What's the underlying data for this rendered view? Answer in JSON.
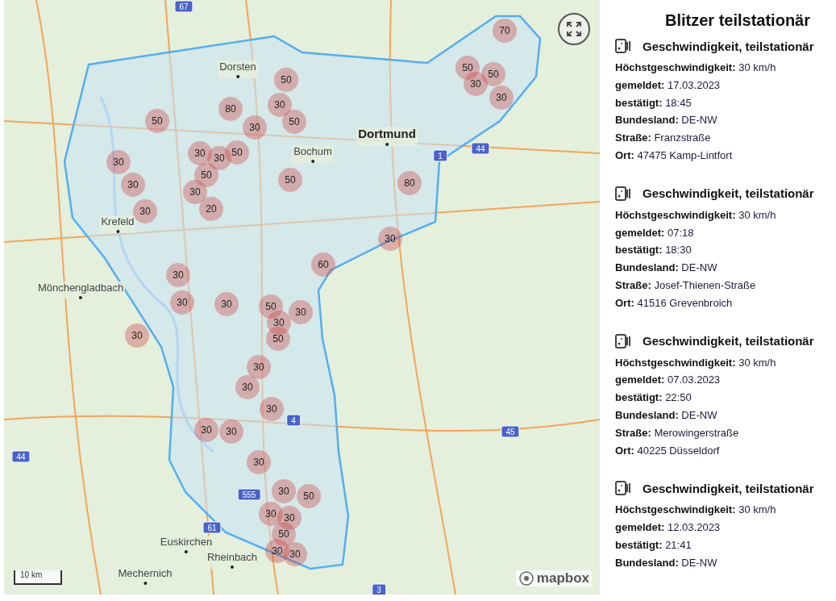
{
  "map": {
    "markers": [
      "70",
      "50",
      "30",
      "50",
      "30",
      "50",
      "30",
      "50",
      "80",
      "30",
      "50",
      "30",
      "30",
      "50",
      "50",
      "30",
      "30",
      "50",
      "30",
      "20",
      "80",
      "30",
      "30",
      "60",
      "30",
      "30",
      "30",
      "50",
      "30",
      "50",
      "30",
      "30",
      "30",
      "30",
      "30",
      "30",
      "30",
      "30",
      "30",
      "50",
      "30",
      "30",
      "50",
      "30",
      "30"
    ],
    "places": [
      {
        "name": "Dorsten",
        "kind": "town"
      },
      {
        "name": "Dortmund",
        "kind": "city"
      },
      {
        "name": "Bochum",
        "kind": "town"
      },
      {
        "name": "Krefeld",
        "kind": "town"
      },
      {
        "name": "Mönchengladbach",
        "kind": "town"
      },
      {
        "name": "Euskirchen",
        "kind": "town"
      },
      {
        "name": "Rheinbach",
        "kind": "town"
      },
      {
        "name": "Mechernich",
        "kind": "town"
      }
    ],
    "road_shields": [
      "67",
      "1",
      "44",
      "4",
      "45",
      "44",
      "555",
      "61",
      "3"
    ],
    "scale": "10 km",
    "attribution": "mapbox"
  },
  "sidebar": {
    "title": "Blitzer teilstationär",
    "entries": [
      {
        "title": "Geschwindigkeit, teilstationär",
        "fields": [
          {
            "label": "Höchstgeschwindigkeit:",
            "value": "30 km/h"
          },
          {
            "label": "gemeldet:",
            "value": "17.03.2023"
          },
          {
            "label": "bestätigt:",
            "value": "18:45"
          },
          {
            "label": "Bundesland:",
            "value": "DE-NW"
          },
          {
            "label": "Straße:",
            "value": "Franzstraße"
          },
          {
            "label": "Ort:",
            "value": "47475 Kamp-Lintfort"
          }
        ]
      },
      {
        "title": "Geschwindigkeit, teilstationär",
        "fields": [
          {
            "label": "Höchstgeschwindigkeit:",
            "value": "30 km/h"
          },
          {
            "label": "gemeldet:",
            "value": "07:18"
          },
          {
            "label": "bestätigt:",
            "value": "18:30"
          },
          {
            "label": "Bundesland:",
            "value": "DE-NW"
          },
          {
            "label": "Straße:",
            "value": "Josef-Thienen-Straße"
          },
          {
            "label": "Ort:",
            "value": "41516 Grevenbroich"
          }
        ]
      },
      {
        "title": "Geschwindigkeit, teilstationär",
        "fields": [
          {
            "label": "Höchstgeschwindigkeit:",
            "value": "30 km/h"
          },
          {
            "label": "gemeldet:",
            "value": "07.03.2023"
          },
          {
            "label": "bestätigt:",
            "value": "22:50"
          },
          {
            "label": "Bundesland:",
            "value": "DE-NW"
          },
          {
            "label": "Straße:",
            "value": "Merowingerstraße"
          },
          {
            "label": "Ort:",
            "value": "40225 Düsseldorf"
          }
        ]
      },
      {
        "title": "Geschwindigkeit, teilstationär",
        "fields": [
          {
            "label": "Höchstgeschwindigkeit:",
            "value": "30 km/h"
          },
          {
            "label": "gemeldet:",
            "value": "12.03.2023"
          },
          {
            "label": "bestätigt:",
            "value": "21:41"
          },
          {
            "label": "Bundesland:",
            "value": "DE-NW"
          }
        ]
      }
    ]
  }
}
